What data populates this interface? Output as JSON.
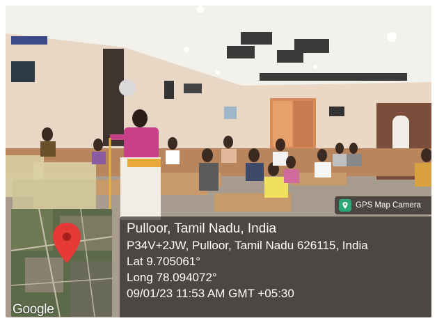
{
  "photo": {
    "description_icon": "classroom-photo"
  },
  "map": {
    "pin_color": "#e53935",
    "provider_logo": "Google"
  },
  "badge": {
    "label": "GPS Map Camera",
    "icon": "gps-camera-icon"
  },
  "location": {
    "title": "Pulloor, Tamil Nadu, India",
    "address": "P34V+2JW, Pulloor, Tamil Nadu 626115, India",
    "lat": "Lat 9.705061°",
    "long": "Long 78.094072°",
    "datetime": "09/01/23 11:53 AM GMT +05:30"
  }
}
